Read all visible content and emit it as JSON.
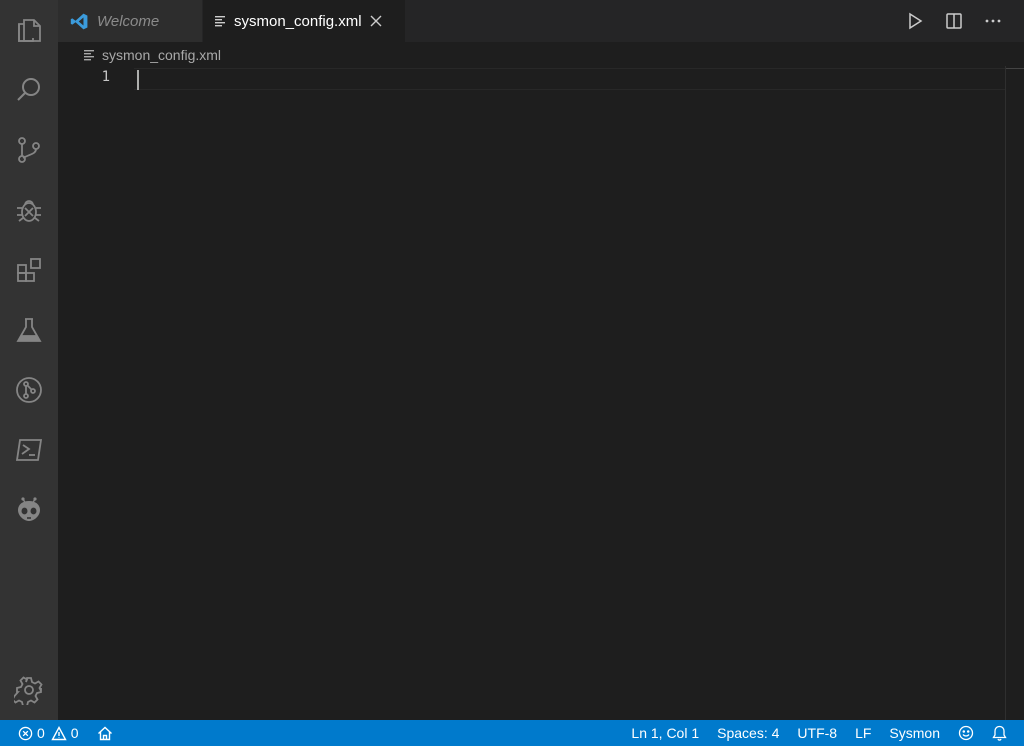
{
  "tabs": [
    {
      "label": "Welcome",
      "icon": "vscode-logo-icon",
      "active": false
    },
    {
      "label": "sysmon_config.xml",
      "icon": "file-lines-icon",
      "active": true
    }
  ],
  "breadcrumb": {
    "file": "sysmon_config.xml"
  },
  "editor": {
    "line_numbers": [
      "1"
    ],
    "content": ""
  },
  "status": {
    "errors": "0",
    "warnings": "0",
    "position": "Ln 1, Col 1",
    "spaces": "Spaces: 4",
    "encoding": "UTF-8",
    "eol": "LF",
    "language": "Sysmon"
  },
  "activity_bar": [
    "files-icon",
    "search-icon",
    "source-control-icon",
    "debug-icon",
    "extensions-icon",
    "testing-icon",
    "git-graph-icon",
    "powershell-icon",
    "platformio-icon",
    "settings-gear-icon"
  ],
  "colors": {
    "statusbar": "#007acc",
    "activity_bar": "#333333",
    "editor": "#1e1e1e",
    "accent": "#3b9bdb"
  }
}
